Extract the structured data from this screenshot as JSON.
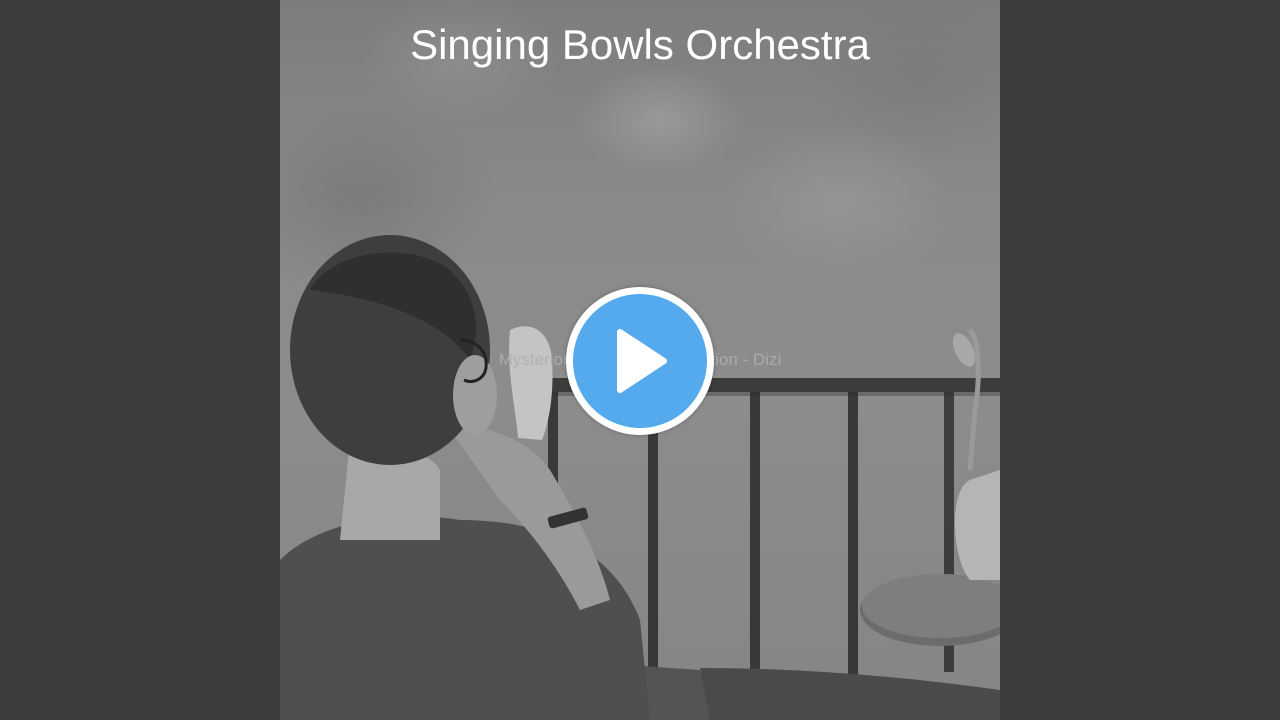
{
  "video": {
    "channel_title": "Singing Bowls Orchestra",
    "track_title": "Mysterious Music for Meditation - Dizi"
  },
  "controls": {
    "play_icon": "play-icon",
    "play_color": "#55aaee"
  },
  "colors": {
    "background": "#3d3d3d",
    "title_text": "#ffffff"
  }
}
